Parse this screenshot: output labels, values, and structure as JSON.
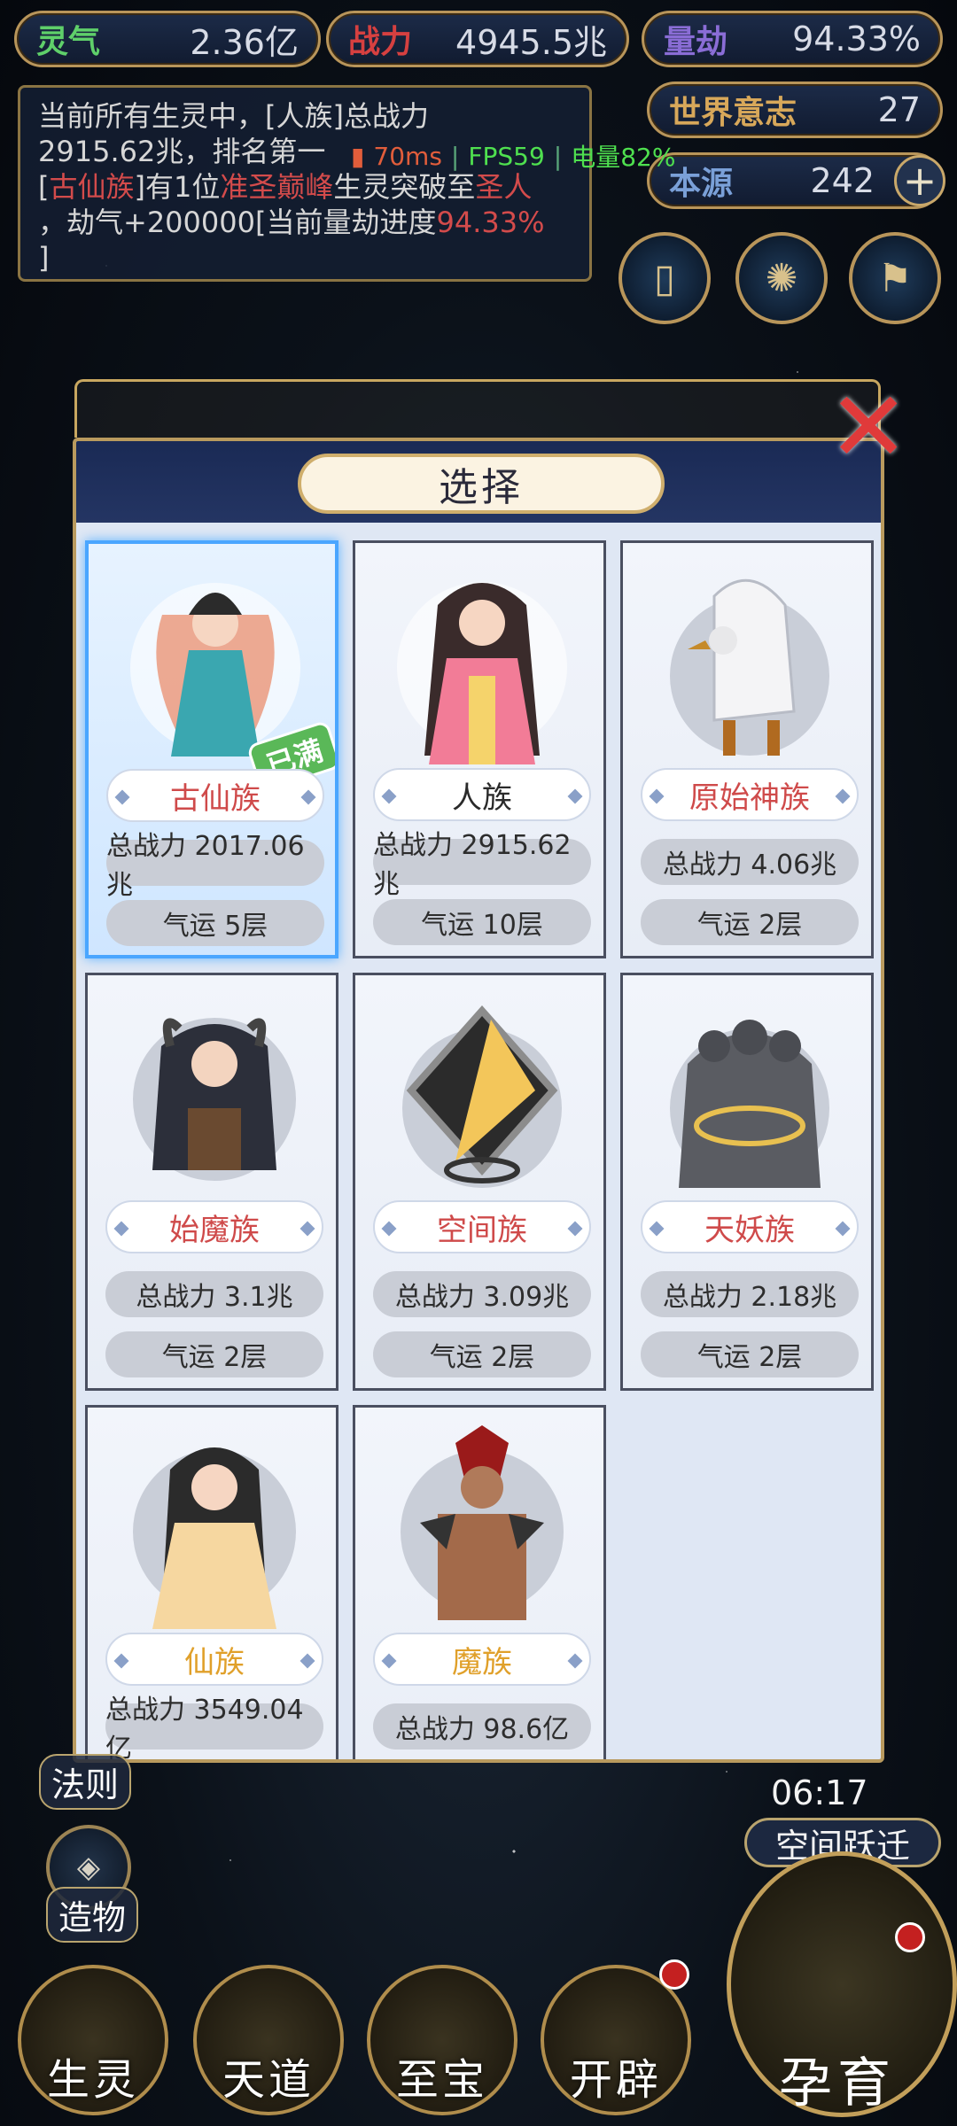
{
  "hud": {
    "lingqi": {
      "label": "灵气",
      "value": "2.36亿"
    },
    "zhanli": {
      "label": "战力",
      "value": "4945.5兆"
    },
    "liangjie": {
      "label": "量劫",
      "value": "94.33%"
    },
    "world_will": {
      "label": "世界意志",
      "value": "27"
    },
    "benyuan": {
      "label": "本源",
      "value": "242"
    },
    "plus_symbol": "+"
  },
  "log": {
    "line1": "当前所有生灵中，[人族]总战力",
    "line2": "2915.62兆，排名第一",
    "l3_a": "[",
    "l3_b": "古仙族",
    "l3_c": "]有1位",
    "l3_d": "准圣巅峰",
    "l3_e": "生灵突破至",
    "l3_f": "圣人",
    "line4a": "，劫气+200000[当前量劫进度",
    "line4b": "94.33%",
    "line5": "]"
  },
  "net": {
    "ping": "70ms",
    "fps": "FPS59",
    "battery": "电量82%"
  },
  "modal": {
    "title": "选择",
    "close": "✕",
    "cards": [
      {
        "name": "古仙族",
        "power": "总战力 2017.06兆",
        "luck": "气运 5层",
        "badge": "已满",
        "selected": true
      },
      {
        "name": "人族",
        "power": "总战力 2915.62兆",
        "luck": "气运 10层"
      },
      {
        "name": "原始神族",
        "power": "总战力 4.06兆",
        "luck": "气运 2层"
      },
      {
        "name": "始魔族",
        "power": "总战力 3.1兆",
        "luck": "气运 2层"
      },
      {
        "name": "空间族",
        "power": "总战力 3.09兆",
        "luck": "气运 2层"
      },
      {
        "name": "天妖族",
        "power": "总战力 2.18兆",
        "luck": "气运 2层"
      },
      {
        "name": "仙族",
        "power": "总战力 3549.04亿"
      },
      {
        "name": "魔族",
        "power": "总战力 98.6亿"
      }
    ]
  },
  "side": {
    "fazhe": "法则",
    "zaowu": "造物",
    "timer": "06:17",
    "jump": "空间跃迁"
  },
  "bottom": {
    "shengling": "生灵",
    "tiandao": "天道",
    "zhibao": "至宝",
    "kaipi": "开辟",
    "yunyu": "孕育"
  },
  "colors": {
    "accent_gold": "#b8955a",
    "selected_blue": "#4aa6ff",
    "red_text": "#d34b4b"
  }
}
